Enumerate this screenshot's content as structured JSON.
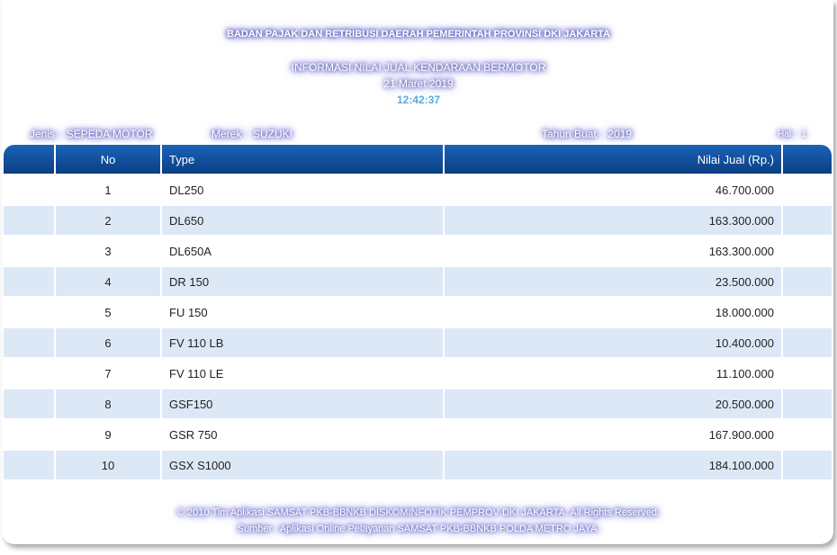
{
  "header": {
    "agency": "BADAN PAJAK DAN RETRIBUSI DAERAH PEMERINTAH PROVINSI DKI JAKARTA",
    "info_title": "INFORMASI NILAI JUAL KENDARAAN BERMOTOR",
    "date": "21 Maret 2019",
    "time": "12:42:37"
  },
  "meta": {
    "jenis_label": "Jenis :",
    "jenis_value": "SEPEDA MOTOR",
    "merek_label": "Merek :",
    "merek_value": "SUZUKI",
    "tahun_label": "Tahun Buat :",
    "tahun_value": "2019",
    "hal_label": "Hal :",
    "hal_value": "1"
  },
  "table": {
    "columns": {
      "no": "No",
      "type": "Type",
      "nilai": "Nilai Jual (Rp.)"
    },
    "rows": [
      {
        "no": "1",
        "type": "DL250",
        "nilai": "46.700.000"
      },
      {
        "no": "2",
        "type": "DL650",
        "nilai": "163.300.000"
      },
      {
        "no": "3",
        "type": "DL650A",
        "nilai": "163.300.000"
      },
      {
        "no": "4",
        "type": "DR 150",
        "nilai": "23.500.000"
      },
      {
        "no": "5",
        "type": "FU 150",
        "nilai": "18.000.000"
      },
      {
        "no": "6",
        "type": "FV 110 LB",
        "nilai": "10.400.000"
      },
      {
        "no": "7",
        "type": "FV 110 LE",
        "nilai": "11.100.000"
      },
      {
        "no": "8",
        "type": "GSF150",
        "nilai": "20.500.000"
      },
      {
        "no": "9",
        "type": "GSR 750",
        "nilai": "167.900.000"
      },
      {
        "no": "10",
        "type": "GSX S1000",
        "nilai": "184.100.000"
      }
    ]
  },
  "footer": {
    "copyright": "© 2010 Tim Aplikasi SAMSAT PKB-BBNKB DISKOMINFOTIK PEMPROV DKI JAKARTA. All Rights Reserved.",
    "source": "Sumber : Aplikasi Online Pelayanan SAMSAT PKB-BBNKB POLDA METRO JAYA."
  }
}
